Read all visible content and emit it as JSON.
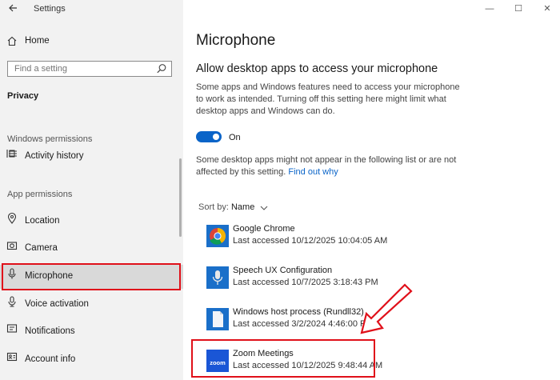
{
  "window": {
    "title": "Settings",
    "controls": {
      "minimize": "—",
      "maximize": "☐",
      "close": "✕"
    }
  },
  "sidebar": {
    "home_label": "Home",
    "search_placeholder": "Find a setting",
    "privacy_heading": "Privacy",
    "windows_permissions_heading": "Windows permissions",
    "app_permissions_heading": "App permissions",
    "items": {
      "activity_history": "Activity history",
      "location": "Location",
      "camera": "Camera",
      "microphone": "Microphone",
      "voice_activation": "Voice activation",
      "notifications": "Notifications",
      "account_info": "Account info"
    },
    "active_item": "microphone"
  },
  "main": {
    "page_title": "Microphone",
    "section_title": "Allow desktop apps to access your microphone",
    "description": "Some apps and Windows features need to access your microphone to work as intended. Turning off this setting here might limit what desktop apps and Windows can do.",
    "toggle_state": "On",
    "note_text": "Some desktop apps might not appear in the following list or are not affected by this setting.",
    "note_link": "Find out why",
    "sort_label": "Sort by:",
    "sort_value": "Name",
    "apps": [
      {
        "name": "Google Chrome",
        "last_accessed": "Last accessed 10/12/2025 10:04:05 AM",
        "icon": "chrome-icon"
      },
      {
        "name": "Speech UX Configuration",
        "last_accessed": "Last accessed 10/7/2025 3:18:43 PM",
        "icon": "microphone-app-icon"
      },
      {
        "name": "Windows host process (Rundll32)",
        "last_accessed": "Last accessed 3/2/2024 4:46:00 PM",
        "icon": "document-icon"
      },
      {
        "name": "Zoom Meetings",
        "last_accessed": "Last accessed 10/12/2025 9:48:44 AM",
        "icon": "zoom-icon"
      }
    ],
    "zoom_icon_text": "zoom"
  },
  "colors": {
    "accent": "#0a64c8",
    "highlight": "#e0101a",
    "sidebar_bg": "#f2f2f2",
    "active_bg": "#d9d9d9"
  }
}
